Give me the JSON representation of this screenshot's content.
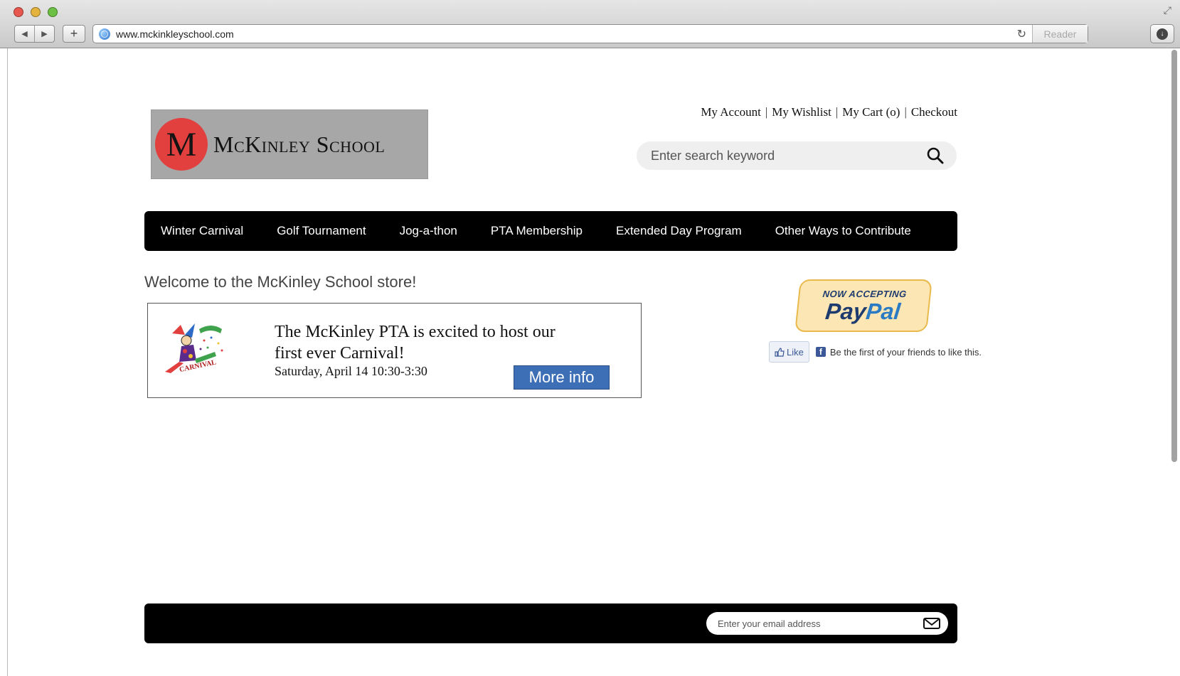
{
  "browser": {
    "url": "www.mckinkleyschool.com",
    "reader_label": "Reader",
    "new_tab_glyph": "+",
    "back_glyph": "◀",
    "forward_glyph": "▶",
    "reload_glyph": "↻"
  },
  "header": {
    "logo_letter": "M",
    "logo_text": "McKinley School",
    "links": {
      "account": "My Account",
      "wishlist": "My Wishlist",
      "cart": "My Cart (o)",
      "checkout": "Checkout",
      "separator": "|"
    },
    "search_placeholder": "Enter search keyword"
  },
  "nav": {
    "items": [
      "Winter Carnival",
      "Golf Tournament",
      "Jog-a-thon",
      "PTA Membership",
      "Extended Day Program",
      "Other Ways to Contribute"
    ]
  },
  "main": {
    "welcome": "Welcome to the McKinley School store!",
    "banner": {
      "title": "The McKinley PTA  is excited to host our first ever Carnival!",
      "date": "Saturday, April 14 10:30-3:30",
      "button": "More info",
      "image_text": "CARNIVAL"
    }
  },
  "sidebar": {
    "paypal_top": "NOW ACCEPTING",
    "paypal_pay": "Pay",
    "paypal_pal": "Pal",
    "fb_like": "Like",
    "fb_text": "Be the first of your friends to like this."
  },
  "footer": {
    "email_placeholder": "Enter your email address"
  },
  "colors": {
    "nav_bg": "#000000",
    "logo_bg": "#a7a7a7",
    "logo_circle": "#e23f3f",
    "button_blue": "#3d6fb6",
    "paypal_bg": "#fce7b4"
  }
}
